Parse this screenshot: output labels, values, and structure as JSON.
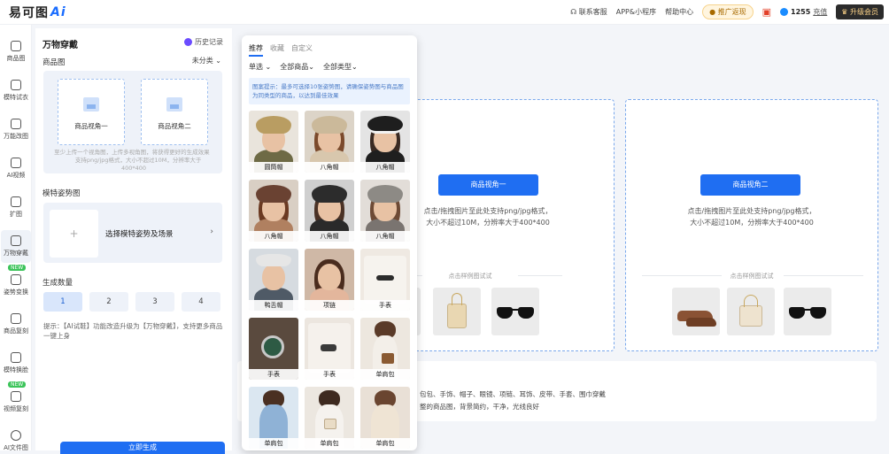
{
  "topbar": {
    "logo_text": "易可图",
    "logo_ai": "Ai",
    "service": "联系客服",
    "app": "APP&小程序",
    "help": "帮助中心",
    "promo": "推广返现",
    "coins": "1255",
    "recharge": "充值",
    "upgrade": "升级会员"
  },
  "sidenav": [
    {
      "label": "商品图"
    },
    {
      "label": "模特试衣"
    },
    {
      "label": "万能改图"
    },
    {
      "label": "AI视频"
    },
    {
      "label": "扩图"
    },
    {
      "label": "万物穿戴"
    },
    {
      "label": "姿势变换",
      "badge": "NEW"
    },
    {
      "label": "商品复刻"
    },
    {
      "label": "模特换脸"
    },
    {
      "label": "视频复刻",
      "badge": "NEW"
    },
    {
      "label": "AI文件图"
    }
  ],
  "panel": {
    "title": "万物穿戴",
    "history": "历史记录",
    "product_label": "商品图",
    "category": "未分类",
    "upload1": "商品视角一",
    "upload2": "商品视角二",
    "upload_hint": "至少上传一个视角图，上传多视角图，将获得更好的生成效果        支持png/jpg格式，大小不超过10M，分辨率大于400*400",
    "pose_label": "模特姿势图",
    "pose_placeholder": "选择模特姿势及场景",
    "count_label": "生成数量",
    "counts": [
      "1",
      "2",
      "3",
      "4"
    ],
    "tip": "提示：【AI试鞋】功能改造升级为【万物穿戴】，支持更多商品一键上身",
    "generate": "立即生成"
  },
  "popup": {
    "tabs": [
      "推荐",
      "收藏",
      "自定义"
    ],
    "filters": [
      "单选",
      "全部商品",
      "全部类型"
    ],
    "notice": "图案提示：最多可选择10张姿势图，请确保姿势图与商品图为同类型的商品，以达到最佳效果",
    "items": [
      "圆筒帽",
      "八角帽",
      "八角帽",
      "八角帽",
      "八角帽",
      "八角帽",
      "鸭舌帽",
      "项链",
      "手表",
      "手表",
      "手表",
      "单肩包",
      "单肩包",
      "单肩包",
      "单肩包"
    ]
  },
  "main": {
    "card1_button": "商品视角一",
    "card2_button": "商品视角二",
    "card_desc_line1": "点击/拖拽图片至此处支持png/jpg格式，",
    "card_desc_line2": "大小不超过10M，分辨率大于400*400",
    "try_label": "点击样例图试试",
    "note_line1": "包包、手饰、帽子、眼镜、项链、耳饰、皮带、手套、围巾穿戴",
    "note_line2": "整的商品图，背景简约，干净，光线良好"
  },
  "colors": {
    "accent": "#1f6ef2",
    "new_badge": "#3cc45a"
  }
}
